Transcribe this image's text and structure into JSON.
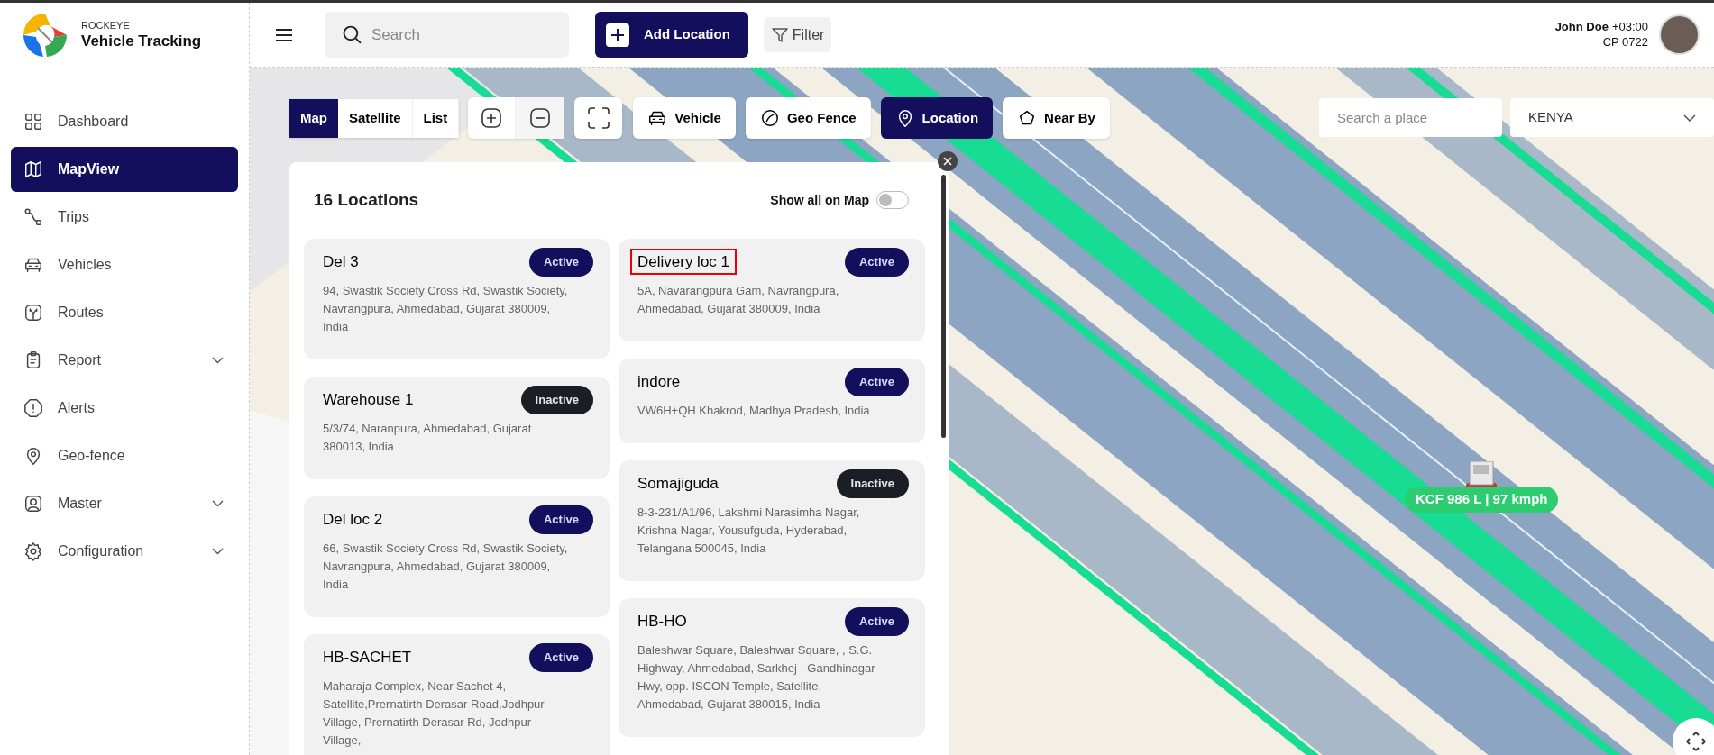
{
  "brand": {
    "small": "ROCKEYE",
    "name": "Vehicle Tracking"
  },
  "sidebar": {
    "items": [
      {
        "label": "Dashboard",
        "kind": "dashboard",
        "selected": false,
        "expandable": false
      },
      {
        "label": "MapView",
        "kind": "map",
        "selected": true,
        "expandable": false
      },
      {
        "label": "Trips",
        "kind": "trips",
        "selected": false,
        "expandable": false
      },
      {
        "label": "Vehicles",
        "kind": "car",
        "selected": false,
        "expandable": false
      },
      {
        "label": "Routes",
        "kind": "routes",
        "selected": false,
        "expandable": false
      },
      {
        "label": "Report",
        "kind": "report",
        "selected": false,
        "expandable": true
      },
      {
        "label": "Alerts",
        "kind": "alert",
        "selected": false,
        "expandable": false
      },
      {
        "label": "Geo-fence",
        "kind": "pin",
        "selected": false,
        "expandable": false
      },
      {
        "label": "Master",
        "kind": "user",
        "selected": false,
        "expandable": true
      },
      {
        "label": "Configuration",
        "kind": "gear",
        "selected": false,
        "expandable": true
      }
    ]
  },
  "header": {
    "search": {
      "placeholder": "Search"
    },
    "add_button": "Add Location",
    "filter_button": "Filter",
    "user": {
      "name": "John Doe",
      "timezone": "+03:00",
      "code": "CP 0722"
    }
  },
  "map": {
    "view_modes": [
      {
        "label": "Map",
        "selected": true
      },
      {
        "label": "Satellite",
        "selected": false
      },
      {
        "label": "List",
        "selected": false
      }
    ],
    "layers": [
      {
        "label": "Vehicle",
        "kind": "car",
        "selected": false
      },
      {
        "label": "Geo Fence",
        "kind": "ring",
        "selected": false
      },
      {
        "label": "Location",
        "kind": "pin",
        "selected": true
      },
      {
        "label": "Near By",
        "kind": "pentagon",
        "selected": false
      }
    ],
    "place_search": {
      "placeholder": "Search a place"
    },
    "country": "KENYA",
    "vehicle_marker": {
      "label": "KCF 986 L | 97 kmph"
    }
  },
  "locations_panel": {
    "title": "16 Locations",
    "show_all_label": "Show all on Map",
    "show_all_on_map": false,
    "columns": [
      [
        {
          "name": "Del 3",
          "status": "Active",
          "active": true,
          "highlighted": false,
          "address": "94, Swastik Society Cross Rd, Swastik Society, Navrangpura, Ahmedabad, Gujarat 380009, India"
        },
        {
          "name": "Warehouse 1",
          "status": "Inactive",
          "active": false,
          "highlighted": false,
          "address": "5/3/74, Naranpura, Ahmedabad, Gujarat 380013, India"
        },
        {
          "name": "Del loc 2",
          "status": "Active",
          "active": true,
          "highlighted": false,
          "address": "66, Swastik Society Cross Rd, Swastik Society, Navrangpura, Ahmedabad, Gujarat 380009, India"
        },
        {
          "name": "HB-SACHET",
          "status": "Active",
          "active": true,
          "highlighted": false,
          "address": "Maharaja Complex, Near Sachet 4, Satellite,Prernatirth Derasar Road,Jodhpur Village, Prernatirth Derasar Rd, Jodhpur Village,"
        }
      ],
      [
        {
          "name": "Delivery loc 1",
          "status": "Active",
          "active": true,
          "highlighted": true,
          "address": "5A, Navarangpura Gam, Navrangpura, Ahmedabad, Gujarat 380009, India"
        },
        {
          "name": "indore",
          "status": "Active",
          "active": true,
          "highlighted": false,
          "address": "VW6H+QH Khakrod, Madhya Pradesh, India"
        },
        {
          "name": "Somajiguda",
          "status": "Inactive",
          "active": false,
          "highlighted": false,
          "address": "8-3-231/A1/96, Lakshmi Narasimha Nagar, Krishna Nagar, Yousufguda, Hyderabad, Telangana 500045, India"
        },
        {
          "name": "HB-HO",
          "status": "Active",
          "active": true,
          "highlighted": false,
          "address": "Baleshwar Square, Baleshwar Square, , S.G. Highway, Ahmedabad, Sarkhej - Gandhinagar Hwy, opp. ISCON Temple, Satellite, Ahmedabad, Gujarat 380015, India"
        }
      ]
    ]
  }
}
